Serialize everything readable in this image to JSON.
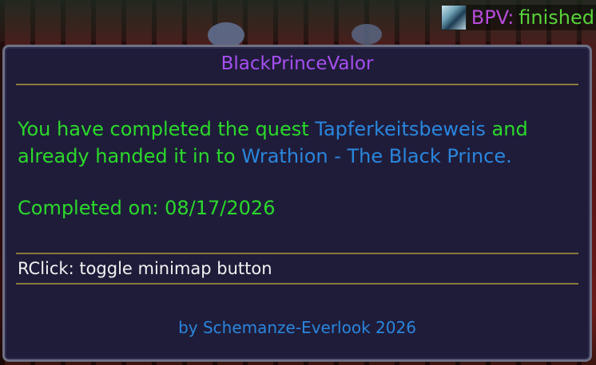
{
  "status": {
    "icon": "prince-portrait-icon",
    "label": "BPV:",
    "value": "finished"
  },
  "tooltip": {
    "title": "BlackPrinceValor",
    "body_text_1": "You have completed the quest ",
    "quest_name": "Tapferkeitsbeweis",
    "body_text_2": " and already handed it in to ",
    "npc_name": "Wrathion - The Black Prince",
    "body_text_3": ".",
    "completed_label": "Completed on: 08/17/2026",
    "hint": "RClick: toggle minimap button",
    "footer": "by Schemanze-Everlook 2026"
  },
  "colors": {
    "title": "#a64ff0",
    "body": "#2bd92b",
    "link": "#2a86dc",
    "hint": "#f2f2f2",
    "panel_bg": "#1f1c3a",
    "rule": "#8a7a3a"
  }
}
